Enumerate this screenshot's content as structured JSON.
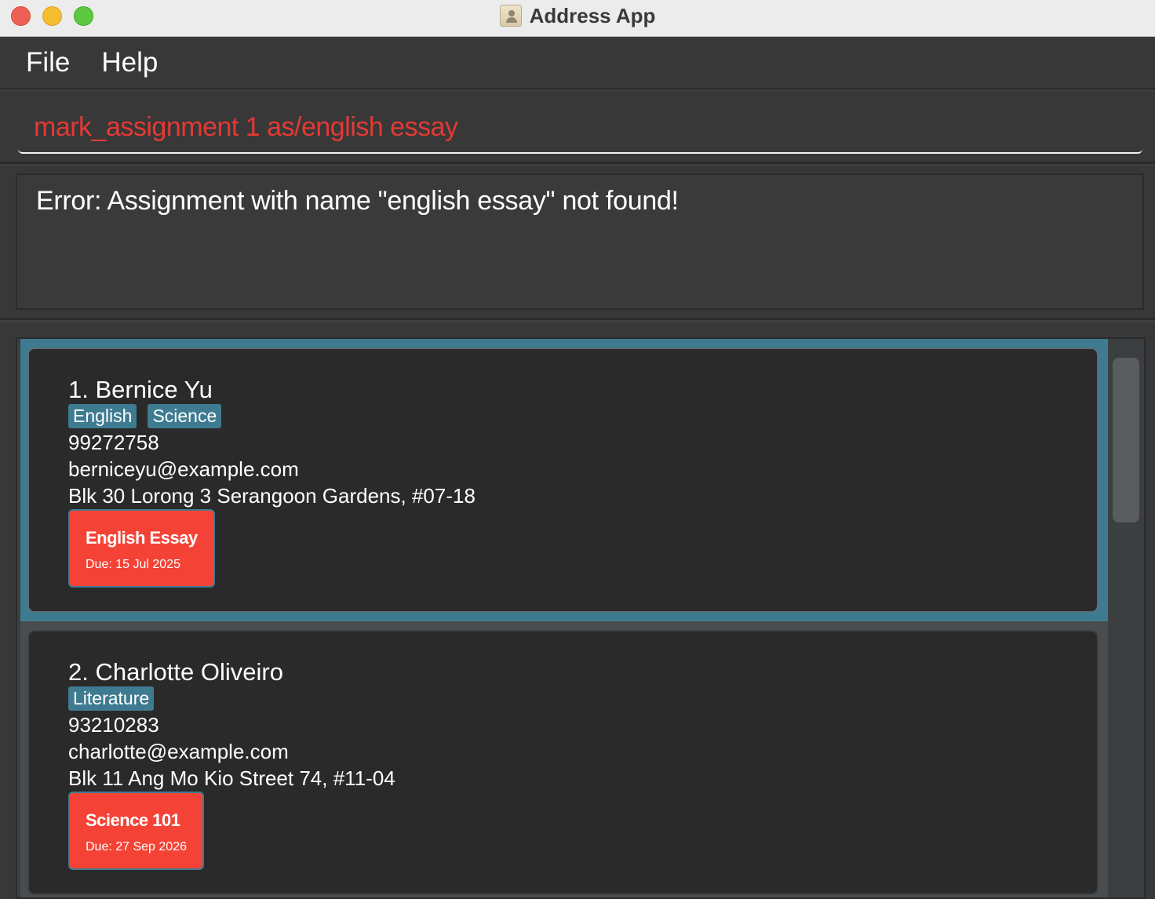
{
  "window": {
    "title": "Address App"
  },
  "menu": {
    "file": "File",
    "help": "Help"
  },
  "command": {
    "value": "mark_assignment 1 as/english essay"
  },
  "result": {
    "message": "Error: Assignment with name \"english essay\" not found!"
  },
  "persons": [
    {
      "name": "1. Bernice Yu",
      "tags": [
        "English",
        "Science"
      ],
      "phone": "99272758",
      "email": "berniceyu@example.com",
      "address": "Blk 30 Lorong 3 Serangoon Gardens, #07-18",
      "assignment": {
        "name": "English Essay",
        "due": "Due: 15 Jul 2025"
      }
    },
    {
      "name": "2. Charlotte Oliveiro",
      "tags": [
        "Literature"
      ],
      "phone": "93210283",
      "email": "charlotte@example.com",
      "address": "Blk 11 Ang Mo Kio Street 74, #11-04",
      "assignment": {
        "name": "Science 101",
        "due": "Due: 27 Sep 2026"
      }
    }
  ],
  "colors": {
    "accent": "#3e7b91",
    "error_text": "#e53935",
    "assignment_bg": "#f44336",
    "card_bg": "#2a2a2a"
  }
}
